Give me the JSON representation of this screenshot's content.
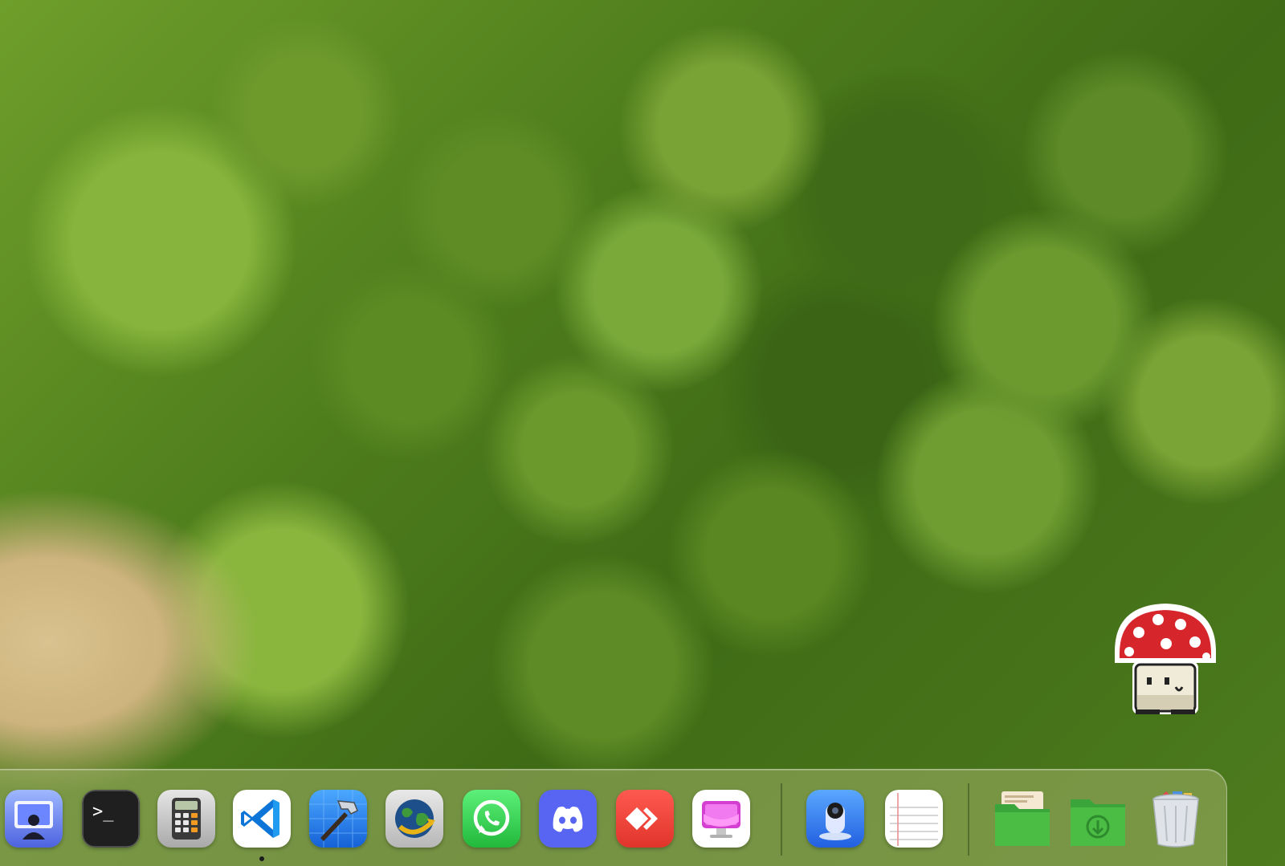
{
  "desktop": {
    "sprite_icon": "pixel-mushroom-icon"
  },
  "dock": {
    "apps": [
      {
        "icon": "screen-sharing-icon",
        "running": false
      },
      {
        "icon": "terminal-icon",
        "text": ">_",
        "running": false
      },
      {
        "icon": "calculator-icon",
        "running": false
      },
      {
        "icon": "vscode-icon",
        "running": true
      },
      {
        "icon": "xcode-icon",
        "running": false
      },
      {
        "icon": "globe-fetch-icon",
        "running": false
      },
      {
        "icon": "whatsapp-icon",
        "running": false
      },
      {
        "icon": "discord-icon",
        "running": false
      },
      {
        "icon": "anydesk-icon",
        "running": false
      },
      {
        "icon": "cleanmymac-icon",
        "running": false
      }
    ],
    "recent_apps": [
      {
        "icon": "image-capture-icon"
      },
      {
        "icon": "textedit-icon"
      }
    ],
    "stacks": [
      {
        "icon": "documents-folder-icon"
      },
      {
        "icon": "downloads-folder-icon"
      },
      {
        "icon": "trash-full-icon"
      }
    ]
  }
}
